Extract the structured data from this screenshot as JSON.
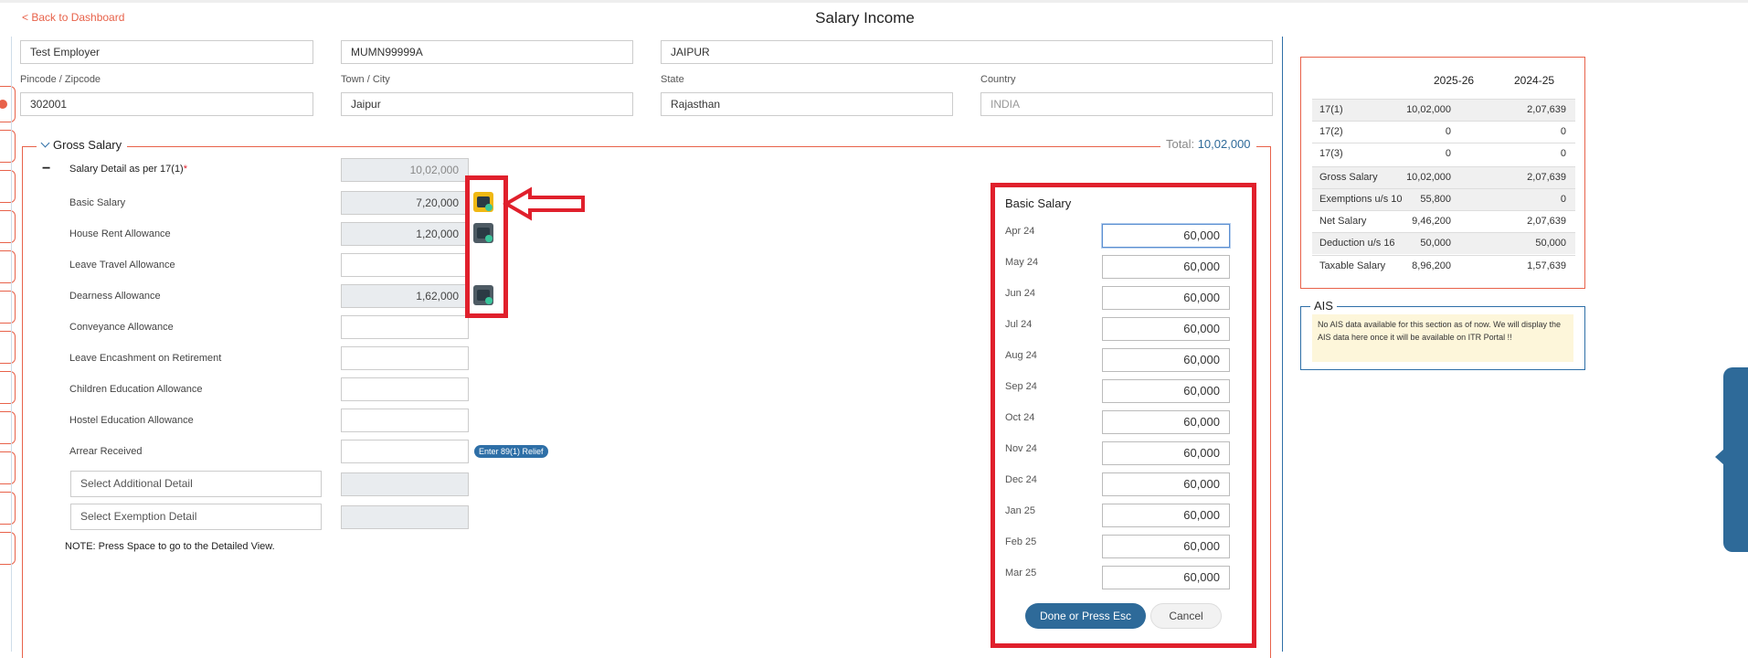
{
  "header": {
    "back_link": "< Back to Dashboard",
    "title": "Salary Income"
  },
  "employer": {
    "name": "Test Employer",
    "tan": "MUMN99999A",
    "address": "JAIPUR",
    "pincode_label": "Pincode / Zipcode",
    "pincode": "302001",
    "town_label": "Town / City",
    "town": "Jaipur",
    "state_label": "State",
    "state": "Rajasthan",
    "country_label": "Country",
    "country": "INDIA"
  },
  "gross_salary": {
    "section_title": "Gross Salary",
    "total_label": "Total:",
    "total_value": "10,02,000",
    "collapse_symbol": "−",
    "detail_label": "Salary Detail as per 17(1)",
    "required_mark": "*",
    "detail_value": "10,02,000",
    "rows": [
      {
        "label": "Basic Salary",
        "value": "7,20,000"
      },
      {
        "label": "House Rent Allowance",
        "value": "1,20,000"
      },
      {
        "label": "Leave Travel Allowance",
        "value": ""
      },
      {
        "label": "Dearness Allowance",
        "value": "1,62,000"
      },
      {
        "label": "Conveyance Allowance",
        "value": ""
      },
      {
        "label": "Leave Encashment on Retirement",
        "value": ""
      },
      {
        "label": "Children Education Allowance",
        "value": ""
      },
      {
        "label": "Hostel Education Allowance",
        "value": ""
      },
      {
        "label": "Arrear Received",
        "value": ""
      }
    ],
    "relief_badge": "Enter 89(1) Relief",
    "additional_select": "Select Additional Detail",
    "exemption_select": "Select Exemption Detail",
    "note": "NOTE: Press Space to go to the Detailed View."
  },
  "monthly_panel": {
    "title": "Basic Salary",
    "months": [
      {
        "month": "Apr 24",
        "value": "60,000"
      },
      {
        "month": "May 24",
        "value": "60,000"
      },
      {
        "month": "Jun 24",
        "value": "60,000"
      },
      {
        "month": "Jul 24",
        "value": "60,000"
      },
      {
        "month": "Aug 24",
        "value": "60,000"
      },
      {
        "month": "Sep 24",
        "value": "60,000"
      },
      {
        "month": "Oct 24",
        "value": "60,000"
      },
      {
        "month": "Nov 24",
        "value": "60,000"
      },
      {
        "month": "Dec 24",
        "value": "60,000"
      },
      {
        "month": "Jan 25",
        "value": "60,000"
      },
      {
        "month": "Feb 25",
        "value": "60,000"
      },
      {
        "month": "Mar 25",
        "value": "60,000"
      }
    ],
    "done_label": "Done or Press Esc",
    "cancel_label": "Cancel"
  },
  "summary": {
    "col1": "2025-26",
    "col2": "2024-25",
    "rows": [
      {
        "label": "17(1)",
        "a": "10,02,000",
        "b": "2,07,639"
      },
      {
        "label": "17(2)",
        "a": "0",
        "b": "0"
      },
      {
        "label": "17(3)",
        "a": "0",
        "b": "0"
      },
      {
        "label": "Gross Salary",
        "a": "10,02,000",
        "b": "2,07,639"
      },
      {
        "label": "Exemptions u/s 10",
        "a": "55,800",
        "b": "0"
      },
      {
        "label": "Net Salary",
        "a": "9,46,200",
        "b": "2,07,639"
      },
      {
        "label": "Deduction u/s 16",
        "a": "50,000",
        "b": "50,000"
      },
      {
        "label": "Taxable Salary",
        "a": "8,96,200",
        "b": "1,57,639"
      }
    ]
  },
  "ais": {
    "title": "AIS",
    "note": "No AIS data available for this section as of now. We will display the AIS data here once it will be available on ITR Portal !!"
  },
  "colors": {
    "accent_red": "#e8624a",
    "highlight_red": "#e0202c",
    "brand_blue": "#2e6fa7",
    "calc_active": "#f0b814"
  },
  "icons": {
    "calculator": "calculator-icon",
    "arrow": "left-arrow-annotation",
    "chevron": "chevron-down-icon"
  }
}
